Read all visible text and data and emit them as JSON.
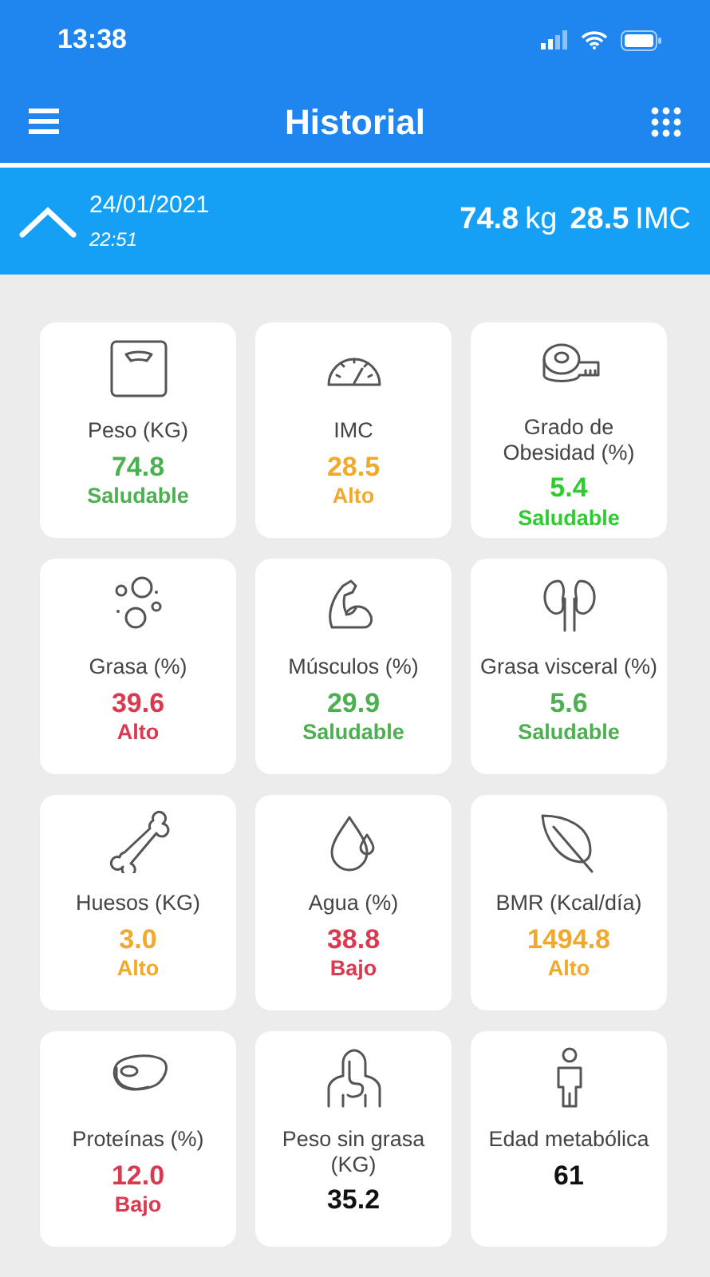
{
  "status_bar": {
    "time": "13:38"
  },
  "nav": {
    "title": "Historial"
  },
  "summary": {
    "date": "24/01/2021",
    "time": "22:51",
    "weight_value": "74.8",
    "weight_unit": "kg",
    "bmi_value": "28.5",
    "bmi_unit": "IMC"
  },
  "metrics": [
    {
      "label": "Peso (KG)",
      "value": "74.8",
      "status": "Saludable",
      "color": "#4caf50"
    },
    {
      "label": "IMC",
      "value": "28.5",
      "status": "Alto",
      "color": "#f0a92a"
    },
    {
      "label": "Grado de Obesidad (%)",
      "value": "5.4",
      "status": "Saludable",
      "color": "#2ecc2e"
    },
    {
      "label": "Grasa (%)",
      "value": "39.6",
      "status": "Alto",
      "color": "#d93a50"
    },
    {
      "label": "Músculos (%)",
      "value": "29.9",
      "status": "Saludable",
      "color": "#4caf50"
    },
    {
      "label": "Grasa visceral (%)",
      "value": "5.6",
      "status": "Saludable",
      "color": "#4caf50"
    },
    {
      "label": "Huesos (KG)",
      "value": "3.0",
      "status": "Alto",
      "color": "#f0a92a"
    },
    {
      "label": "Agua (%)",
      "value": "38.8",
      "status": "Bajo",
      "color": "#d93a50"
    },
    {
      "label": "BMR (Kcal/día)",
      "value": "1494.8",
      "status": "Alto",
      "color": "#f0a92a"
    },
    {
      "label": "Proteínas (%)",
      "value": "12.0",
      "status": "Bajo",
      "color": "#d93a50"
    },
    {
      "label": "Peso sin grasa (KG)",
      "value": "35.2",
      "color": "#111111"
    },
    {
      "label": "Edad metabólica",
      "value": "61",
      "color": "#111111"
    }
  ]
}
